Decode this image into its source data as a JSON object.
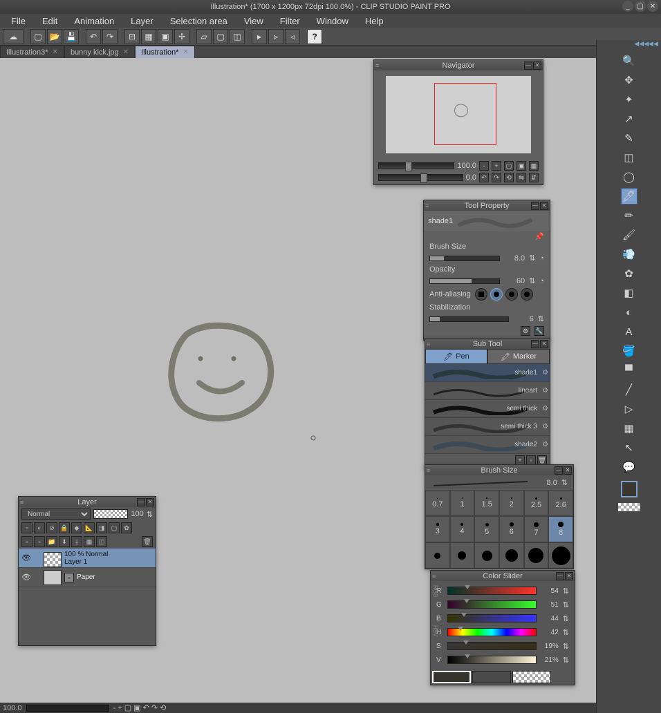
{
  "title": "Illustration* (1700 x 1200px 72dpi 100.0%)  -  CLIP STUDIO PAINT PRO",
  "menus": [
    "File",
    "Edit",
    "Animation",
    "Layer",
    "Selection area",
    "View",
    "Filter",
    "Window",
    "Help"
  ],
  "tabs": [
    {
      "label": "Illustration3*",
      "active": false
    },
    {
      "label": "bunny kick.jpg",
      "active": false
    },
    {
      "label": "Illustration*",
      "active": true
    }
  ],
  "navigator": {
    "title": "Navigator",
    "zoom": "100.0",
    "rotate": "0.0"
  },
  "tool_property": {
    "title": "Tool Property",
    "preset": "shade1",
    "brush_size": {
      "label": "Brush Size",
      "value": "8.0"
    },
    "opacity": {
      "label": "Opacity",
      "value": "60"
    },
    "anti_aliasing": {
      "label": "Anti-aliasing"
    },
    "stabilization": {
      "label": "Stabilization",
      "value": "6"
    }
  },
  "sub_tool": {
    "title": "Sub Tool",
    "tabs": [
      "Pen",
      "Marker"
    ],
    "items": [
      "shade1",
      "lineart",
      "semi thick",
      "semi thick 3",
      "shade2"
    ]
  },
  "brush_size": {
    "title": "Brush Size",
    "value": "8.0",
    "grid_top": [
      "0.7",
      "1",
      "1.5",
      "2",
      "2.5",
      "2.6"
    ],
    "grid_mid": [
      "3",
      "4",
      "5",
      "6",
      "7",
      "8"
    ]
  },
  "color_slider": {
    "title": "Color Slider",
    "rows": [
      {
        "ch": "R",
        "val": "54"
      },
      {
        "ch": "G",
        "val": "51"
      },
      {
        "ch": "B",
        "val": "44"
      },
      {
        "ch": "H",
        "val": "42"
      },
      {
        "ch": "S",
        "val": "19%"
      },
      {
        "ch": "V",
        "val": "21%"
      }
    ]
  },
  "layer_panel": {
    "title": "Layer",
    "mode": "Normal",
    "opacity": "100",
    "layers": [
      {
        "name": "100 % Normal\\nLayer 1",
        "sel": true,
        "checker": true
      },
      {
        "name": "Paper",
        "sel": false,
        "checker": false
      }
    ]
  },
  "status": {
    "zoom": "100.0"
  }
}
